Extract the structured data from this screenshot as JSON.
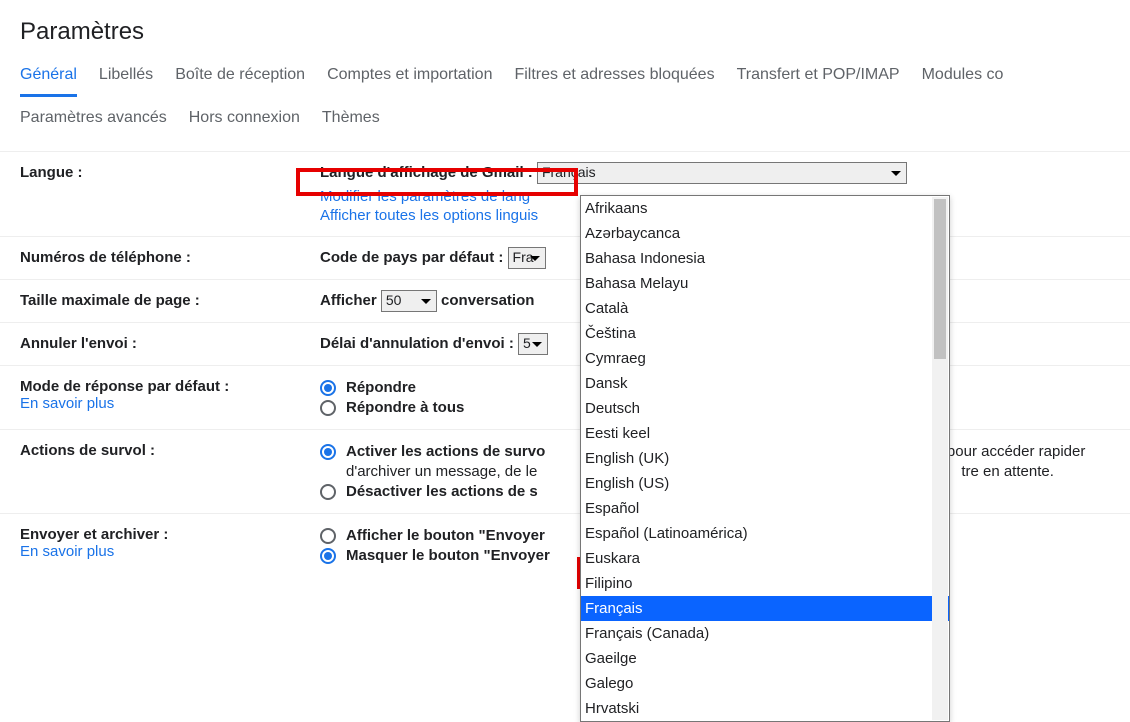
{
  "title": "Paramètres",
  "tabs_row1": [
    "Général",
    "Libellés",
    "Boîte de réception",
    "Comptes et importation",
    "Filtres et adresses bloquées",
    "Transfert et POP/IMAP",
    "Modules co"
  ],
  "tabs_row2": [
    "Paramètres avancés",
    "Hors connexion",
    "Thèmes"
  ],
  "active_tab": "Général",
  "langue": {
    "label": "Langue :",
    "field_label": "Langue d'affichage de Gmail :",
    "selected": "Français",
    "link1": "Modifier les paramètres de lang",
    "link2": "Afficher toutes les options linguis"
  },
  "phone": {
    "label": "Numéros de téléphone :",
    "field_label": "Code de pays par défaut :",
    "selected": "Fra"
  },
  "page_size": {
    "label": "Taille maximale de page :",
    "prefix": "Afficher",
    "value": "50",
    "suffix": "conversation"
  },
  "undo": {
    "label": "Annuler l'envoi :",
    "field_label": "Délai d'annulation d'envoi :",
    "value": "5"
  },
  "reply": {
    "label": "Mode de réponse par défaut :",
    "learn_more": "En savoir plus",
    "opt1": "Répondre",
    "opt2": "Répondre à tous"
  },
  "hover": {
    "label": "Actions de survol :",
    "opt1": "Activer les actions de survo",
    "opt1_desc_a": "s pour accéder rapider",
    "opt1_desc_b": "d'archiver un message, de le",
    "opt1_desc_c": "tre en attente.",
    "opt2": "Désactiver les actions de s"
  },
  "send_archive": {
    "label": "Envoyer et archiver :",
    "learn_more": "En savoir plus",
    "opt1": "Afficher le bouton \"Envoyer",
    "opt2": "Masquer le bouton \"Envoyer"
  },
  "dropdown_options": [
    "Afrikaans",
    "Azərbaycanca",
    "Bahasa Indonesia",
    "Bahasa Melayu",
    "Català",
    "Čeština",
    "Cymraeg",
    "Dansk",
    "Deutsch",
    "Eesti keel",
    "English (UK)",
    "English (US)",
    "Español",
    "Español (Latinoamérica)",
    "Euskara",
    "Filipino",
    "Français",
    "Français (Canada)",
    "Gaeilge",
    "Galego",
    "Hrvatski"
  ],
  "dropdown_selected": "Français"
}
